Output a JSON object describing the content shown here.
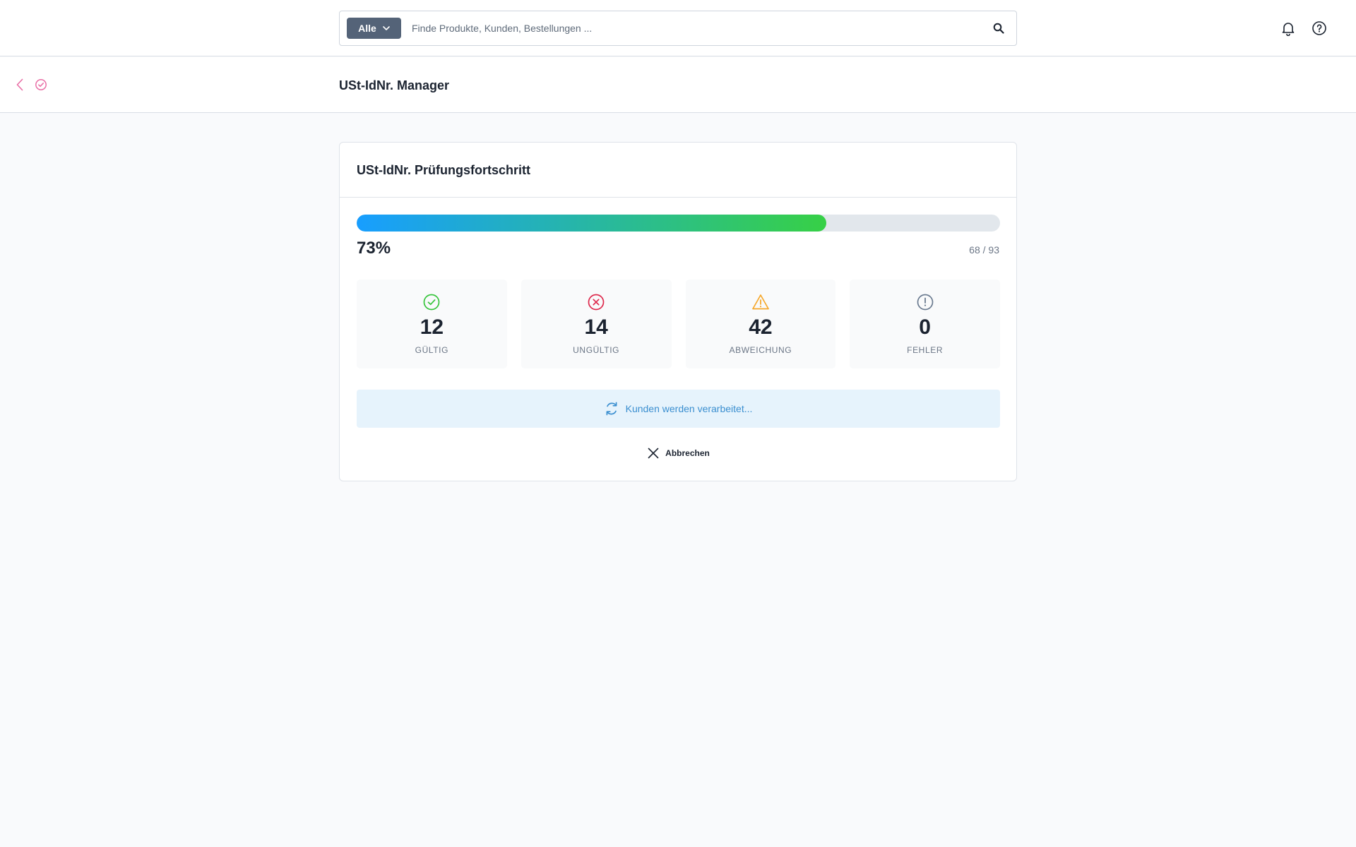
{
  "topbar": {
    "search": {
      "type_label": "Alle",
      "placeholder": "Finde Produkte, Kunden, Bestellungen ..."
    },
    "icons": [
      "bell-icon",
      "help-icon",
      "search-icon"
    ]
  },
  "smartbar": {
    "title": "USt-IdNr. Manager"
  },
  "card": {
    "title": "USt-IdNr. Prüfungsfortschritt",
    "progress": {
      "percent_label": "73%",
      "fraction": 0.73,
      "count_label": "68 / 93"
    },
    "stats": [
      {
        "value": "12",
        "label": "GÜLTIG",
        "icon": "check-circle-icon",
        "color": "#37c53c"
      },
      {
        "value": "14",
        "label": "UNGÜLTIG",
        "icon": "x-circle-icon",
        "color": "#de294c"
      },
      {
        "value": "42",
        "label": "ABWEICHUNG",
        "icon": "warning-icon",
        "color": "#f6a82c"
      },
      {
        "value": "0",
        "label": "FEHLER",
        "icon": "info-circle-icon",
        "color": "#6b7b90"
      }
    ],
    "status_text": "Kunden werden verarbeitet...",
    "cancel_label": "Abbrechen"
  },
  "colors": {
    "accent_pink": "#e96fa6",
    "search_type_bg": "#546378",
    "progress_start": "#189eff",
    "progress_end": "#37d046",
    "banner_bg": "#e6f3fc",
    "banner_text": "#3b8fd0"
  }
}
